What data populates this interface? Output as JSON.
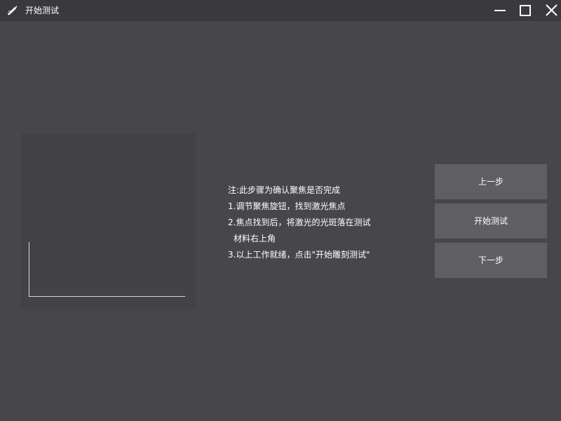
{
  "window": {
    "title": "开始测试",
    "app_icon": "laser-pen-icon",
    "controls": {
      "minimize": "minimize-icon",
      "maximize": "maximize-icon",
      "close": "close-icon"
    }
  },
  "instructions": {
    "note": "注:此步骤为确认聚焦是否完成",
    "step1": "1.调节聚焦旋钮，找到激光焦点",
    "step2": "2.焦点找到后，将激光的光斑落在测试",
    "step2_cont": "材料右上角",
    "step3": "3.以上工作就绪，点击\"开始雕刻测试\""
  },
  "buttons": {
    "prev_label": "上一步",
    "start_label": "开始测试",
    "next_label": "下一步"
  },
  "colors": {
    "background": "#47464b",
    "titlebar": "#3a393e",
    "panel": "#434247",
    "button": "#5f5e63",
    "text": "#ffffff"
  }
}
